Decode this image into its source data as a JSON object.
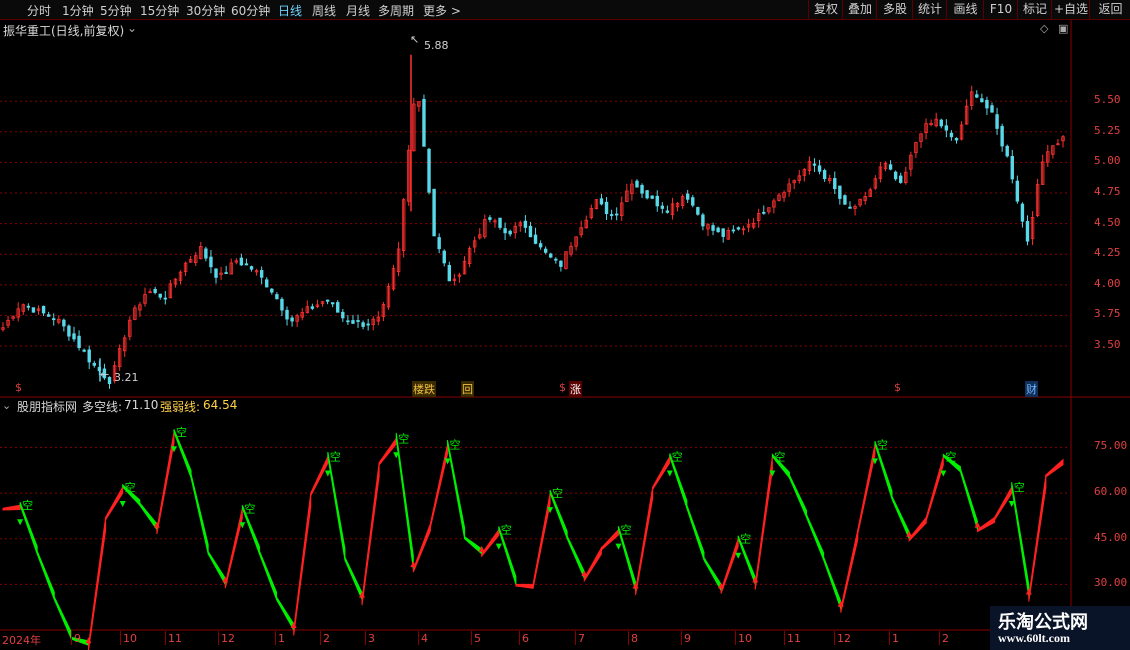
{
  "toolbar": {
    "periods": [
      "分时",
      "1分钟",
      "5分钟",
      "15分钟",
      "30分钟",
      "60分钟",
      "日线",
      "周线",
      "月线",
      "多周期",
      "更多 >"
    ],
    "active_period": "日线",
    "right_buttons": [
      "复权",
      "叠加",
      "多股",
      "统计",
      "画线",
      "F10",
      "标记",
      "+自选",
      "返回"
    ]
  },
  "main_panel": {
    "title": "振华重工(日线,前复权)",
    "high_label": "5.88",
    "low_label": "3.21",
    "event_markers": [
      "$",
      "楼跌",
      "回",
      "$",
      "涨",
      "$",
      "财"
    ]
  },
  "indicator_panel": {
    "name": "股朋指标网",
    "line1_label": "多空线:",
    "line1_value": "71.10",
    "line2_label": "强弱线:",
    "line2_value": "64.54",
    "signal_label": "空"
  },
  "colors": {
    "up": "#ff3030",
    "down": "#58d8e8",
    "bull": "#ff2020",
    "bear": "#00ee00",
    "grid": "#8a0000",
    "axis_text": "#e04040"
  },
  "chart_data": [
    {
      "type": "candlestick",
      "title": "振华重工(日线,前复权)",
      "yticks": [
        3.5,
        3.75,
        4.0,
        4.25,
        4.5,
        4.75,
        5.0,
        5.25,
        5.5
      ],
      "ylim": [
        3.1,
        6.0
      ],
      "high": 5.88,
      "low": 3.21,
      "close_path": [
        3.65,
        3.85,
        3.78,
        3.72,
        3.55,
        3.35,
        3.21,
        3.7,
        3.95,
        3.9,
        4.15,
        4.3,
        4.05,
        4.2,
        4.12,
        3.95,
        3.7,
        3.8,
        3.88,
        3.72,
        3.68,
        3.72,
        4.25,
        5.7,
        4.4,
        3.98,
        4.3,
        4.55,
        4.42,
        4.5,
        4.28,
        4.15,
        4.45,
        4.68,
        4.55,
        4.85,
        4.7,
        4.62,
        4.75,
        4.5,
        4.4,
        4.45,
        4.55,
        4.72,
        4.85,
        5.0,
        4.85,
        4.6,
        4.7,
        5.0,
        4.8,
        5.25,
        5.35,
        5.15,
        5.6,
        5.4,
        5.0,
        4.35,
        5.1,
        5.2
      ]
    },
    {
      "type": "line",
      "title": "股朋指标网",
      "yticks": [
        30.0,
        45.0,
        60.0,
        75.0
      ],
      "ylim": [
        15,
        85
      ],
      "series": [
        {
          "name": "多空线",
          "last": 71.1,
          "values": [
            55,
            56,
            40,
            25,
            12,
            10,
            52,
            62,
            56,
            48,
            80,
            65,
            40,
            30,
            55,
            40,
            25,
            15,
            60,
            72,
            38,
            25,
            70,
            78,
            35,
            50,
            76,
            45,
            40,
            48,
            30,
            30,
            60,
            45,
            32,
            42,
            48,
            28,
            62,
            72,
            55,
            38,
            28,
            45,
            30,
            72,
            65,
            52,
            38,
            22,
            48,
            76,
            58,
            45,
            52,
            72,
            67,
            48,
            52,
            62,
            26,
            66,
            71
          ]
        },
        {
          "name": "强弱线",
          "last": 64.54
        }
      ],
      "x_tick_labels": [
        "2024年",
        "9",
        "10",
        "11",
        "12",
        "1",
        "2",
        "3",
        "4",
        "5",
        "6",
        "7",
        "8",
        "9",
        "10",
        "11",
        "12",
        "1",
        "2"
      ]
    }
  ],
  "watermark": {
    "line1": "乐淘公式网",
    "line2": "www.60lt.com"
  }
}
